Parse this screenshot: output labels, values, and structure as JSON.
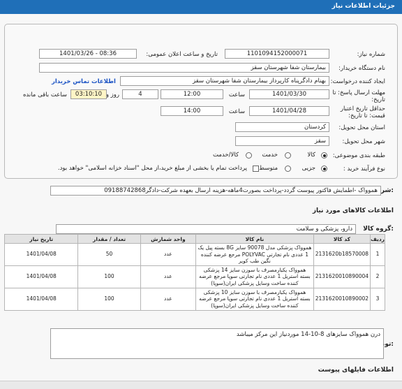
{
  "header": {
    "title": "جزئیات اطلاعات نیاز"
  },
  "form": {
    "need_number_label": "شماره نیاز:",
    "need_number": "1101094152000071",
    "announce_label": "تاریخ و ساعت اعلان عمومی:",
    "announce_value": "1401/03/26 - 08:36",
    "buyer_org_label": "نام دستگاه خریدار:",
    "buyer_org": "بیمارستان شفا شهرستان سقز",
    "creator_label": "ایجاد کننده درخواست:",
    "creator": "بهنام دادگرپناه کارپرداز بیمارستان شفا شهرستان سقز",
    "contact_link": "اطلاعات تماس خریدار",
    "deadline_label": "مهلت ارسال پاسخ: تا تاریخ:",
    "deadline_date": "1401/03/30",
    "time_label": "ساعت",
    "deadline_time": "12:00",
    "days_value": "4",
    "days_label": "روز و",
    "remaining_time": "03:10:10",
    "remaining_label": "ساعت باقی مانده",
    "min_validity_label": "حداقل تاریخ اعتبار قیمت: تا تاریخ:",
    "validity_date": "1401/04/28",
    "validity_time_label": "ساعت",
    "validity_time": "14:00",
    "province_label": "استان محل تحویل:",
    "province": "کردستان",
    "city_label": "شهر محل تحویل:",
    "city": "سقز",
    "category_label": "طبقه بندی موضوعی:",
    "category_options": [
      "کالا",
      "خدمت",
      "کالا/خدمت"
    ],
    "category_selected": "کالا",
    "process_label": "نوع فرآیند خرید :",
    "process_options": [
      "جزیی",
      "متوسط"
    ],
    "process_selected": "جزیی",
    "payment_note": "پرداخت تمام یا بخشی از مبلغ خرید،از محل \"اسناد خزانه اسلامی\" خواهد بود."
  },
  "description": {
    "label": "شرح کلی نیاز:",
    "text": "هموواک -اطمایش فاکتور پیوست گردد-پرداخت بصورت4ماهه-هزینه ارسال بعهده شرکت-دادگر09188742868"
  },
  "goods": {
    "section_title": "اطلاعات کالاهای مورد نیاز",
    "group_label": "گروه کالا:",
    "group_value": "دارو، پزشکی و سلامت",
    "columns": [
      "ردیف",
      "کد کالا",
      "نام کالا",
      "واحد شمارش",
      "تعداد / مقدار",
      "تاریخ نیاز"
    ],
    "rows": [
      {
        "row": "1",
        "code": "2131620b18570008",
        "name": "هموواک پزشکی مدل 90078 سایز 8G بسته پیل یک 1 عددی نام تجارتی POLYVAC مرجع عرضه کننده نگین طب کویر",
        "unit": "عدد",
        "qty": "50",
        "date": "1401/04/08"
      },
      {
        "row": "2",
        "code": "2131620010890004",
        "name": "هموواک یکبارمصرف با سوزن سایز 14 پزشکی بسته استریل 1 عددی نام تجارتی سوپا مرجع عرضه کننده ساخت وسایل پزشکی ایران(سوپا)",
        "unit": "عدد",
        "qty": "100",
        "date": "1401/04/08"
      },
      {
        "row": "3",
        "code": "2131620010890002",
        "name": "هموواک یکبارمصرف با سوزن سایز 10 پزشکی بسته استریل 1 عددی نام تجارتی سوپا مرجع عرضه کننده ساخت وسایل پزشکی ایران(سوپا)",
        "unit": "عدد",
        "qty": "100",
        "date": "1401/04/08"
      }
    ]
  },
  "notes": {
    "label": "توضیحات خریدار:",
    "text": "درن هموواک سایزهای 8-10-14 موردنیاز این مرکز میباشد"
  },
  "attachments": {
    "label": "اطلاعات فایلهای پیوست"
  }
}
